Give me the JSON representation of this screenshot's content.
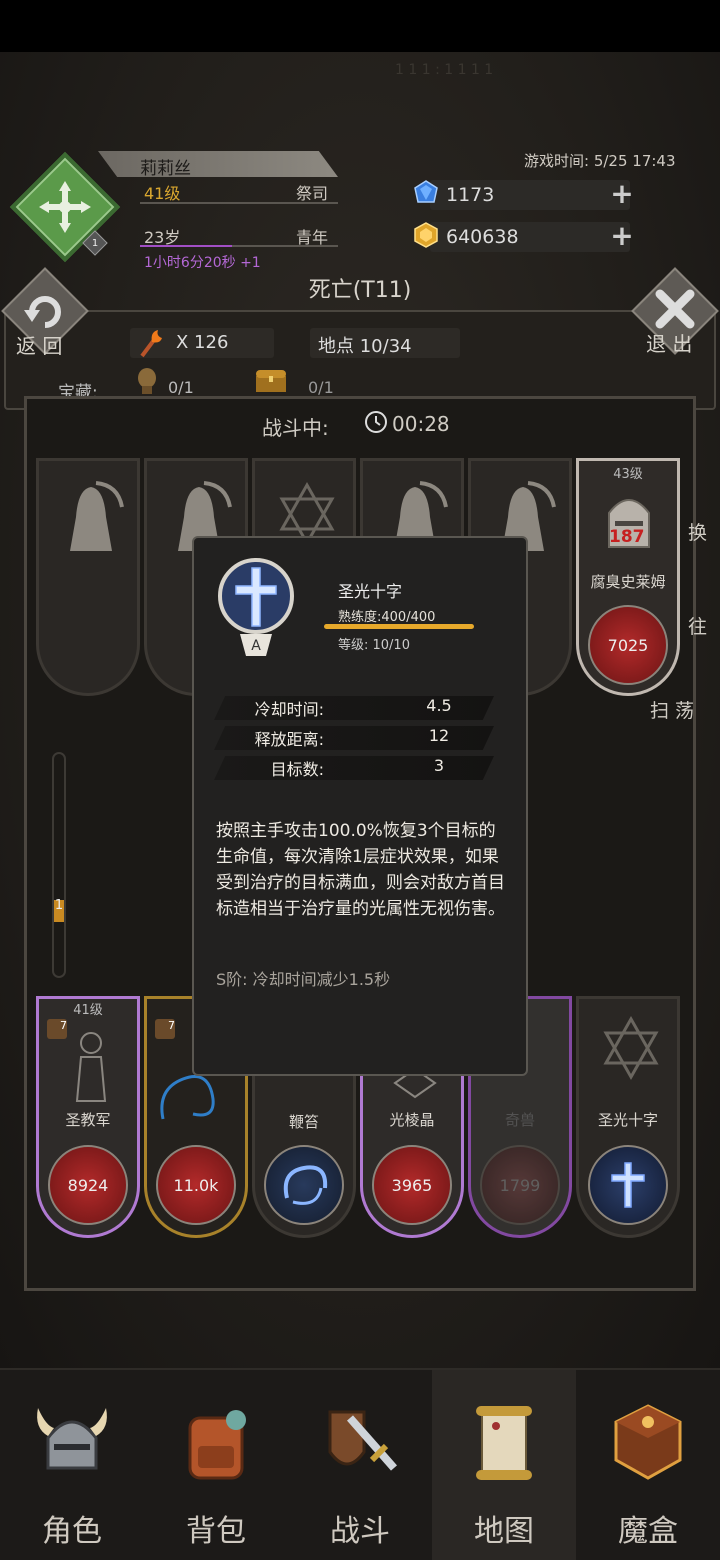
{
  "status_ghost": "1 1 1 : 1 1 1 1",
  "player": {
    "name": "莉莉丝",
    "level": "41级",
    "class": "祭司",
    "age": "23岁",
    "age_stage": "青年",
    "age_timer": "1小时6分20秒 +1",
    "class_level_badge": "1"
  },
  "game_time": "游戏时间: 5/25 17:43",
  "resources": {
    "gem": "1173",
    "gold": "640638"
  },
  "location": {
    "title": "死亡(T11)",
    "back_label": "返 回",
    "exit_label": "退 出",
    "torch_count": "X 126",
    "spot": "地点 10/34",
    "treasure_label": "宝藏:",
    "treasure_count": "0/1",
    "chest_count": "0/1"
  },
  "battle": {
    "status": "战斗中:",
    "timer": "00:28",
    "wave": "1"
  },
  "enemies": [
    {
      "name": ""
    },
    {
      "name": ""
    },
    {
      "name": ""
    },
    {
      "name": ""
    },
    {
      "name": ""
    },
    {
      "level": "43级",
      "name": "腐臭史莱姆",
      "hp": "7025",
      "damage": "187"
    }
  ],
  "side_buttons": {
    "swap": "换",
    "auto": "往",
    "sweep": "扫 荡"
  },
  "allies": [
    {
      "level": "41级",
      "name": "圣教军",
      "hp": "8924",
      "badge": "7"
    },
    {
      "name": "",
      "hp": "11.0k",
      "badge": "7"
    },
    {
      "name": "鞭笞",
      "hp": ""
    },
    {
      "name": "光棱晶",
      "hp": "3965"
    },
    {
      "name": "奇兽",
      "hp": "1799"
    },
    {
      "name": "圣光十字",
      "hp": ""
    }
  ],
  "tooltip": {
    "skill_name": "圣光十字",
    "rank_letter": "A",
    "proficiency": "熟练度:400/400",
    "grade": "等级: 10/10",
    "attrs": [
      {
        "label": "冷却时间:",
        "value": "4.5"
      },
      {
        "label": "释放距离:",
        "value": "12"
      },
      {
        "label": "目标数:",
        "value": "3"
      }
    ],
    "description": "按照主手攻击100.0%恢复3个目标的生命值，每次清除1层症状效果，如果受到治疗的目标满血，则会对敌方首目标造相当于治疗量的光属性无视伤害。",
    "s_rank": "S阶: 冷却时间减少1.5秒"
  },
  "nav": [
    {
      "label": "角色",
      "icon": "helmet-icon"
    },
    {
      "label": "背包",
      "icon": "backpack-icon"
    },
    {
      "label": "战斗",
      "icon": "sword-shield-icon"
    },
    {
      "label": "地图",
      "icon": "scroll-map-icon"
    },
    {
      "label": "魔盒",
      "icon": "magic-box-icon"
    }
  ],
  "colors": {
    "gold": "#d9a72f",
    "purple": "#b468d6",
    "class_green": "#5b9a4a",
    "proficiency": "#e7a92b"
  }
}
